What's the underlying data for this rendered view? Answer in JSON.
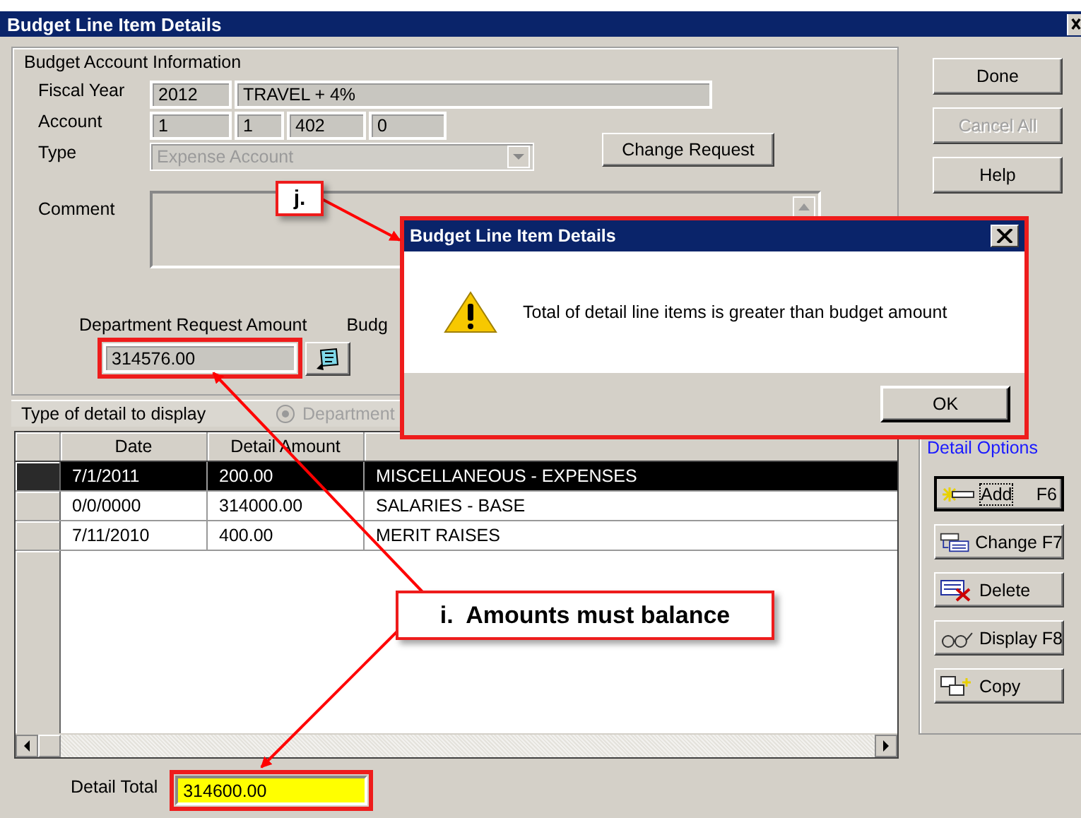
{
  "window": {
    "title": "Budget Line Item Details"
  },
  "account_info": {
    "title": "Budget Account Information",
    "fiscal_year_label": "Fiscal Year",
    "fiscal_year": "2012",
    "fiscal_year_description": "TRAVEL  + 4%",
    "account_label": "Account",
    "account_segments": [
      "1",
      "1",
      "402",
      "0"
    ],
    "type_label": "Type",
    "type": {
      "value": "Expense Account",
      "disabled": true
    },
    "change_request_button": "Change Request",
    "comment_label": "Comment",
    "department_request_amount_label": "Department Request Amount",
    "department_request_amount": "314576.00",
    "budget_label": "Budg"
  },
  "detail_type": {
    "label": "Type of detail to display",
    "option": {
      "label": "Department",
      "disabled": true
    }
  },
  "table": {
    "columns": [
      "Date",
      "Detail Amount"
    ],
    "rows": [
      {
        "date": "7/1/2011",
        "amount": "200.00",
        "description": "MISCELLANEOUS - EXPENSES",
        "selected": true
      },
      {
        "date": "0/0/0000",
        "amount": "314000.00",
        "description": "SALARIES - BASE",
        "selected": false
      },
      {
        "date": "7/11/2010",
        "amount": "400.00",
        "description": "MERIT RAISES",
        "selected": false
      }
    ]
  },
  "detail_total": {
    "label": "Detail Total",
    "value": "314600.00"
  },
  "buttons": [
    {
      "label": "Done",
      "disabled": false
    },
    {
      "label": "Cancel All",
      "disabled": true
    },
    {
      "label": "Help",
      "disabled": false
    }
  ],
  "detail_options": {
    "title": "Detail Options",
    "buttons": [
      {
        "kind": "add",
        "label": "Add",
        "shortcut": "F6",
        "focused": true
      },
      {
        "kind": "change",
        "label": "Change F7",
        "focused": false
      },
      {
        "kind": "delete",
        "label": "Delete",
        "focused": false
      },
      {
        "kind": "display",
        "label": "Display F8",
        "focused": false
      },
      {
        "kind": "copy",
        "label": "Copy",
        "focused": false
      }
    ]
  },
  "dialog": {
    "title": "Budget Line Item Details",
    "message": "Total of detail line items is greater than budget amount",
    "ok_button": "OK"
  },
  "annotations": [
    {
      "label": "j."
    },
    {
      "label": "i.  Amounts must balance"
    }
  ]
}
